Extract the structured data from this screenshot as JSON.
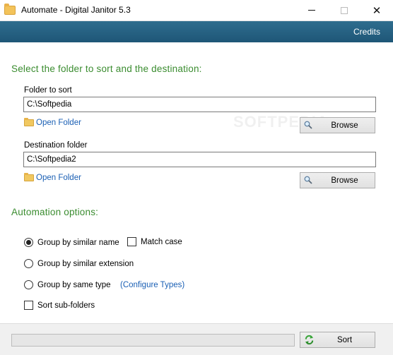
{
  "window": {
    "title": "Automate - Digital Janitor 5.3",
    "min_label": "",
    "close_label": "✕"
  },
  "header": {
    "credits_label": "Credits"
  },
  "folders": {
    "section_title": "Select the folder to sort and the destination:",
    "sort_label": "Folder to sort",
    "sort_value": "C:\\Softpedia",
    "dest_label": "Destination folder",
    "dest_value": "C:\\Softpedia2",
    "open_folder_label": "Open Folder",
    "browse_label": "Browse"
  },
  "automation": {
    "section_title": "Automation options:",
    "group_name_label": "Group by similar name",
    "group_name_checked": true,
    "match_case_label": "Match case",
    "match_case_checked": false,
    "group_ext_label": "Group by similar extension",
    "group_type_label": "Group by same type",
    "configure_types_label": "(Configure Types)",
    "sub_folders_label": "Sort sub-folders",
    "sub_folders_checked": false
  },
  "bottom": {
    "progress_percent": 0,
    "sort_label": "Sort"
  },
  "watermark_text": "SOFTPEDIA",
  "colors": {
    "header_bar": "#2f6d8e",
    "section_title": "#3a8c2f",
    "link": "#1a5fb4"
  }
}
